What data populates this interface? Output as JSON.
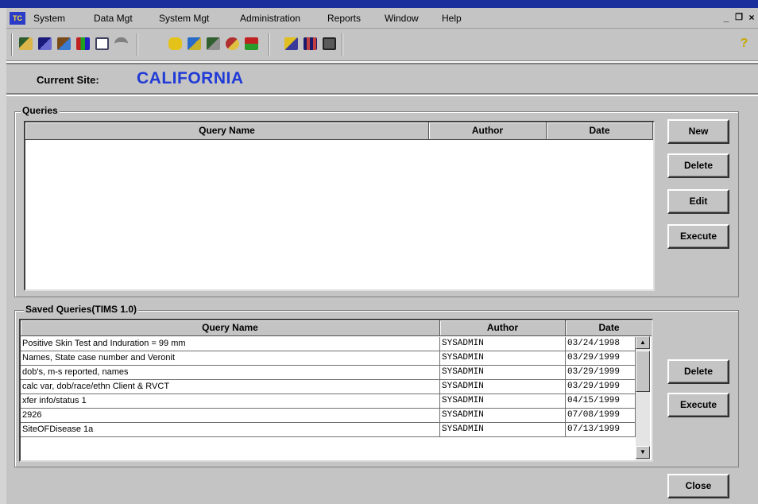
{
  "menubar": {
    "app_icon_text": "TC",
    "items": [
      "System",
      "Data Mgt",
      "System Mgt",
      "Administration",
      "Reports",
      "Window",
      "Help"
    ],
    "window_controls": [
      "_",
      "×"
    ],
    "restore_icon": "restore-icon"
  },
  "toolbar": {
    "icons": [
      "client-icon",
      "case-icon",
      "contacts-icon",
      "chart-icon",
      "report-icon",
      "umbrella-icon",
      "phone-icon",
      "lab-icon",
      "xray-icon",
      "medication-icon",
      "referral-icon",
      "copy-icon",
      "grid-icon",
      "print-icon",
      "help-icon"
    ],
    "help_glyph": "?"
  },
  "site": {
    "label": "Current Site:",
    "value": "CALIFORNIA"
  },
  "queries": {
    "title": "Queries",
    "columns": [
      "Query Name",
      "Author",
      "Date"
    ],
    "rows": [],
    "buttons": {
      "new": "New",
      "delete": "Delete",
      "edit": "Edit",
      "execute": "Execute"
    }
  },
  "saved_queries": {
    "title": "Saved Queries(TIMS 1.0)",
    "columns": [
      "Query Name",
      "Author",
      "Date"
    ],
    "rows": [
      {
        "name": "Positive Skin Test and Induration = 99 mm",
        "author": "SYSADMIN",
        "date": "03/24/1998"
      },
      {
        "name": "Names, State case number and Veronit",
        "author": "SYSADMIN",
        "date": "03/29/1999"
      },
      {
        "name": "dob's, m-s reported, names",
        "author": "SYSADMIN",
        "date": "03/29/1999"
      },
      {
        "name": "calc var, dob/race/ethn Client & RVCT",
        "author": "SYSADMIN",
        "date": "03/29/1999"
      },
      {
        "name": "xfer info/status 1",
        "author": "SYSADMIN",
        "date": "04/15/1999"
      },
      {
        "name": "2926",
        "author": "SYSADMIN",
        "date": "07/08/1999"
      },
      {
        "name": "SiteOFDisease 1a",
        "author": "SYSADMIN",
        "date": "07/13/1999"
      }
    ],
    "buttons": {
      "delete": "Delete",
      "execute": "Execute"
    }
  },
  "footer": {
    "close": "Close"
  },
  "colors": {
    "site_value": "#1f3ad6",
    "face": "#c4c4c4",
    "titlebar": "#1a2e9c"
  }
}
